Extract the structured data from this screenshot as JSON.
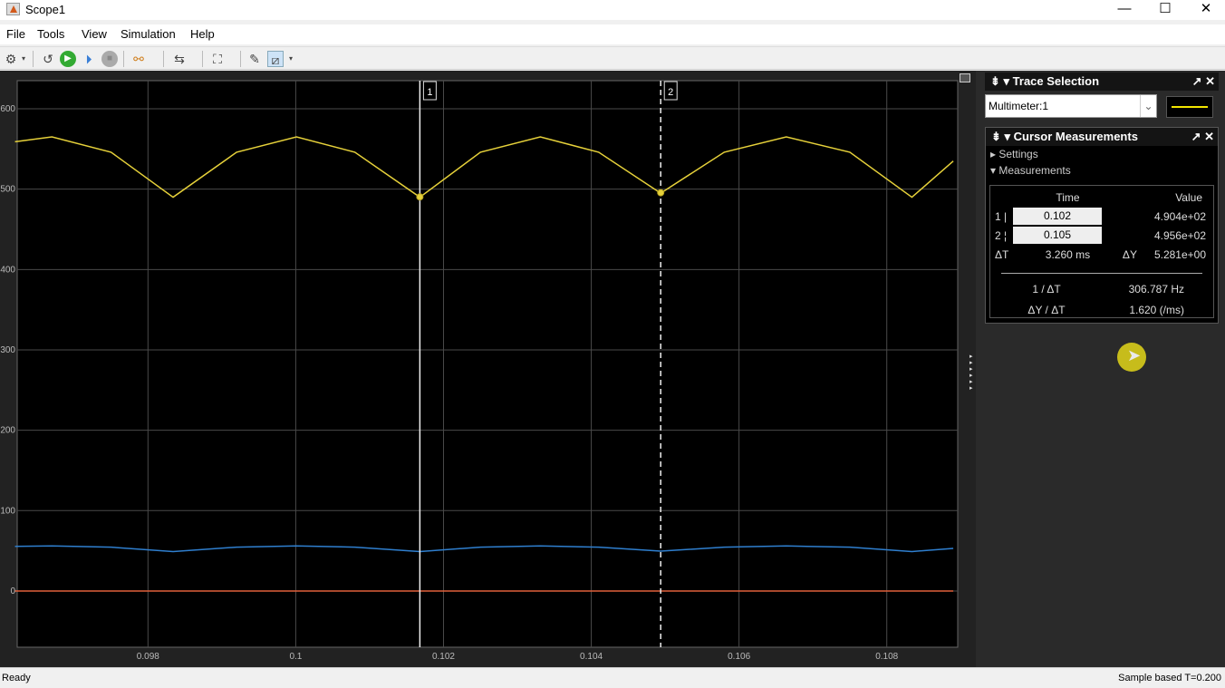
{
  "window": {
    "title": "Scope1",
    "minimize": "—",
    "maximize": "☐",
    "close": "✕"
  },
  "menu": [
    "File",
    "Tools",
    "View",
    "Simulation",
    "Help"
  ],
  "toolbar": {
    "icons": [
      "settings-icon",
      "restore-sim-icon",
      "run-icon",
      "step-forward-icon",
      "stop-icon",
      "highlight-block-icon",
      "triggers-icon",
      "zoom-icon",
      "bring-to-front-icon",
      "cursor-measurements-icon"
    ]
  },
  "trace_selection": {
    "title": "Trace Selection",
    "selected": "Multimeter:1",
    "trace_color": "#f2e600"
  },
  "cursor_measurements": {
    "title": "Cursor Measurements",
    "settings_label": "Settings",
    "measurements_label": "Measurements",
    "col_time": "Time",
    "col_value": "Value",
    "rows": [
      {
        "id": "1",
        "marker": "|",
        "time": "0.102",
        "value": "4.904e+02"
      },
      {
        "id": "2",
        "marker": "¦",
        "time": "0.105",
        "value": "4.956e+02"
      }
    ],
    "dt_label": "ΔT",
    "dt": "3.260 ms",
    "dy_label": "ΔY",
    "dy": "5.281e+00",
    "inv_dt_label": "1 / ΔT",
    "inv_dt": "306.787 Hz",
    "slope_label": "ΔY / ΔT",
    "slope": "1.620 (/ms)"
  },
  "status": {
    "left": "Ready",
    "right": "Sample based  T=0.200"
  },
  "chart_data": {
    "type": "line",
    "xlim": [
      0.09623,
      0.10896
    ],
    "ylim": [
      -70,
      635
    ],
    "grid": true,
    "xticks": [
      "0.098",
      "0.1",
      "0.102",
      "0.104",
      "0.106",
      "0.108"
    ],
    "xtick_values": [
      0.098,
      0.1,
      0.102,
      0.104,
      0.106,
      0.108
    ],
    "yticks": [
      "0",
      "100",
      "200",
      "300",
      "400",
      "500",
      "600"
    ],
    "ytick_values": [
      0,
      100,
      200,
      300,
      400,
      500,
      600
    ],
    "cursors": [
      {
        "label": "1",
        "x": 0.10168,
        "y": 490.4,
        "style": "solid"
      },
      {
        "label": "2",
        "x": 0.10494,
        "y": 495.6,
        "style": "dashed"
      }
    ],
    "series": [
      {
        "color": "#e6d13a",
        "x": [
          0.0962,
          0.0967,
          0.0975,
          0.09834,
          0.0992,
          0.10001,
          0.1008,
          0.10168,
          0.1025,
          0.10331,
          0.1041,
          0.10494,
          0.1058,
          0.10664,
          0.1075,
          0.10834,
          0.1089
        ],
        "y": [
          559,
          565,
          546,
          490,
          546,
          565,
          546,
          490,
          546,
          565,
          546,
          495,
          546,
          565,
          546,
          490,
          535
        ]
      },
      {
        "color": "#2f7fcf",
        "x": [
          0.0962,
          0.0967,
          0.0975,
          0.09834,
          0.0992,
          0.10001,
          0.1008,
          0.10168,
          0.1025,
          0.10331,
          0.1041,
          0.10494,
          0.1058,
          0.10664,
          0.1075,
          0.10834,
          0.1089
        ],
        "y": [
          55.5,
          56,
          54.5,
          49,
          54.5,
          56,
          54.5,
          49,
          54.5,
          56,
          54.5,
          49.5,
          54.5,
          56,
          54.5,
          49,
          53
        ]
      },
      {
        "color": "#e0603a",
        "x": [
          0.0962,
          0.1089
        ],
        "y": [
          0,
          0
        ]
      }
    ]
  }
}
